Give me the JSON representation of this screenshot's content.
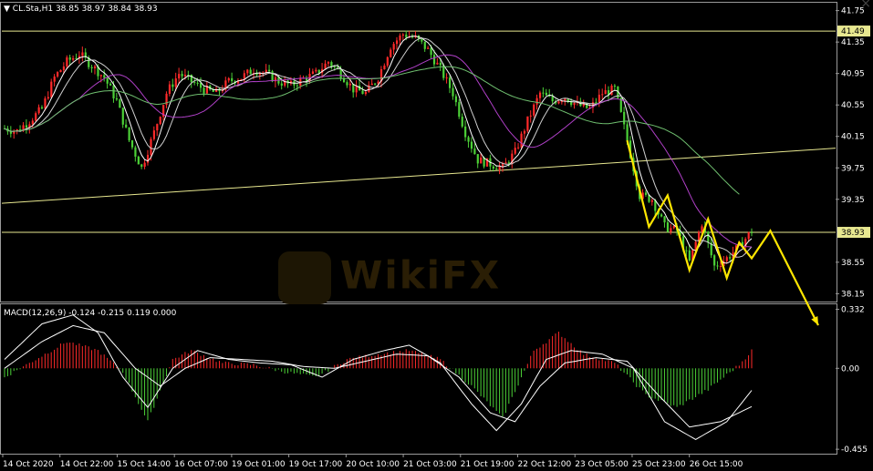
{
  "header": {
    "symbol": "CL.Sta,H1",
    "ohlc": "38.85 38.97 38.84 38.93",
    "macd_label": "MACD(12,26,9)",
    "macd_values": "-0.124 -0.215 0.119 0.000"
  },
  "colors": {
    "background": "#000000",
    "bull": "#ff2a2a",
    "bear": "#4cd137",
    "ma_fast": "#ffffff",
    "ma_mid": "#d0d0d0",
    "ma_slow": "#b040c8",
    "ma_long": "#6fbf6f",
    "level_line": "#e8e890",
    "arrow": "#ffe600",
    "price_box": "#e8e890"
  },
  "watermark": {
    "text": "WikiFX"
  },
  "chart_data": [
    {
      "type": "candlestick",
      "ylim": [
        38.05,
        41.85
      ],
      "price_axis_ticks": [
        41.75,
        41.35,
        40.95,
        40.55,
        40.15,
        39.75,
        39.35,
        38.95,
        38.55,
        38.15
      ],
      "price_axis_labels": [
        "41.75",
        "41.35",
        "40.95",
        "40.55",
        "40.15",
        "39.75",
        "39.35",
        "38.93",
        "38.55",
        "38.15"
      ],
      "highlighted_prices": [
        {
          "value": 41.49,
          "label": "41.49"
        },
        {
          "value": 38.93,
          "label": "38.93"
        }
      ],
      "x_labels": [
        "14 Oct 2020",
        "14 Oct 22:00",
        "15 Oct 14:00",
        "16 Oct 07:00",
        "19 Oct 01:00",
        "19 Oct 17:00",
        "20 Oct 10:00",
        "21 Oct 03:00",
        "21 Oct 19:00",
        "22 Oct 12:00",
        "23 Oct 05:00",
        "25 Oct 23:00",
        "26 Oct 15:00"
      ],
      "close_path": [
        [
          0,
          40.25
        ],
        [
          4,
          40.22
        ],
        [
          8,
          40.35
        ],
        [
          12,
          40.5
        ],
        [
          16,
          40.9
        ],
        [
          20,
          41.1
        ],
        [
          24,
          41.2
        ],
        [
          28,
          41.05
        ],
        [
          32,
          40.9
        ],
        [
          36,
          40.6
        ],
        [
          40,
          40.1
        ],
        [
          44,
          39.75
        ],
        [
          48,
          40.2
        ],
        [
          52,
          40.7
        ],
        [
          56,
          40.95
        ],
        [
          60,
          40.85
        ],
        [
          64,
          40.75
        ],
        [
          68,
          40.7
        ],
        [
          72,
          40.85
        ],
        [
          76,
          40.9
        ],
        [
          80,
          41.0
        ],
        [
          84,
          40.95
        ],
        [
          88,
          40.85
        ],
        [
          92,
          40.8
        ],
        [
          96,
          40.88
        ],
        [
          100,
          40.95
        ],
        [
          104,
          41.1
        ],
        [
          108,
          40.95
        ],
        [
          112,
          40.75
        ],
        [
          116,
          40.7
        ],
        [
          120,
          40.9
        ],
        [
          124,
          41.3
        ],
        [
          128,
          41.45
        ],
        [
          132,
          41.4
        ],
        [
          136,
          41.25
        ],
        [
          140,
          41.0
        ],
        [
          144,
          40.7
        ],
        [
          148,
          40.2
        ],
        [
          152,
          39.85
        ],
        [
          156,
          39.8
        ],
        [
          160,
          39.75
        ],
        [
          164,
          39.95
        ],
        [
          168,
          40.35
        ],
        [
          172,
          40.7
        ],
        [
          176,
          40.6
        ],
        [
          180,
          40.65
        ],
        [
          184,
          40.55
        ],
        [
          188,
          40.5
        ],
        [
          192,
          40.7
        ],
        [
          196,
          40.75
        ],
        [
          200,
          40.1
        ],
        [
          204,
          39.4
        ],
        [
          208,
          39.35
        ],
        [
          212,
          39.0
        ],
        [
          216,
          38.95
        ],
        [
          220,
          38.55
        ],
        [
          224,
          39.05
        ],
        [
          228,
          38.5
        ],
        [
          232,
          38.6
        ],
        [
          236,
          38.75
        ],
        [
          240,
          38.95
        ]
      ]
    },
    {
      "type": "macd",
      "params": "12,26,9",
      "ylim": [
        -0.48,
        0.36
      ],
      "axis_labels": [
        "0.332",
        "0.00",
        "-0.455"
      ],
      "axis_values": [
        0.332,
        0.0,
        -0.455
      ],
      "hist_path": [
        [
          0,
          -0.05
        ],
        [
          10,
          0.05
        ],
        [
          20,
          0.15
        ],
        [
          30,
          0.1
        ],
        [
          38,
          -0.02
        ],
        [
          46,
          -0.3
        ],
        [
          54,
          0.05
        ],
        [
          60,
          0.1
        ],
        [
          70,
          0.03
        ],
        [
          80,
          0.02
        ],
        [
          90,
          -0.02
        ],
        [
          100,
          -0.05
        ],
        [
          110,
          0.05
        ],
        [
          120,
          0.08
        ],
        [
          130,
          0.1
        ],
        [
          140,
          0.05
        ],
        [
          150,
          -0.1
        ],
        [
          160,
          -0.28
        ],
        [
          170,
          0.1
        ],
        [
          178,
          0.2
        ],
        [
          186,
          0.08
        ],
        [
          196,
          0.03
        ],
        [
          206,
          -0.15
        ],
        [
          216,
          -0.22
        ],
        [
          226,
          -0.12
        ],
        [
          236,
          0.02
        ],
        [
          240,
          0.1
        ]
      ],
      "macd_path": [
        [
          0,
          0.05
        ],
        [
          12,
          0.25
        ],
        [
          22,
          0.3
        ],
        [
          30,
          0.2
        ],
        [
          38,
          -0.05
        ],
        [
          46,
          -0.22
        ],
        [
          54,
          0.0
        ],
        [
          62,
          0.1
        ],
        [
          72,
          0.05
        ],
        [
          82,
          0.03
        ],
        [
          92,
          0.02
        ],
        [
          102,
          -0.05
        ],
        [
          112,
          0.05
        ],
        [
          122,
          0.1
        ],
        [
          130,
          0.13
        ],
        [
          140,
          0.03
        ],
        [
          150,
          -0.2
        ],
        [
          158,
          -0.35
        ],
        [
          166,
          -0.2
        ],
        [
          174,
          0.05
        ],
        [
          182,
          0.1
        ],
        [
          192,
          0.08
        ],
        [
          202,
          0.0
        ],
        [
          212,
          -0.3
        ],
        [
          222,
          -0.4
        ],
        [
          232,
          -0.3
        ],
        [
          240,
          -0.124
        ]
      ],
      "signal_path": [
        [
          0,
          0.0
        ],
        [
          12,
          0.15
        ],
        [
          22,
          0.24
        ],
        [
          32,
          0.2
        ],
        [
          42,
          0.0
        ],
        [
          50,
          -0.1
        ],
        [
          58,
          0.0
        ],
        [
          66,
          0.06
        ],
        [
          76,
          0.05
        ],
        [
          86,
          0.04
        ],
        [
          96,
          0.01
        ],
        [
          106,
          0.0
        ],
        [
          116,
          0.04
        ],
        [
          126,
          0.08
        ],
        [
          136,
          0.07
        ],
        [
          146,
          -0.05
        ],
        [
          156,
          -0.25
        ],
        [
          164,
          -0.3
        ],
        [
          172,
          -0.1
        ],
        [
          180,
          0.03
        ],
        [
          190,
          0.06
        ],
        [
          200,
          0.04
        ],
        [
          210,
          -0.15
        ],
        [
          220,
          -0.33
        ],
        [
          230,
          -0.3
        ],
        [
          240,
          -0.215
        ]
      ]
    }
  ]
}
